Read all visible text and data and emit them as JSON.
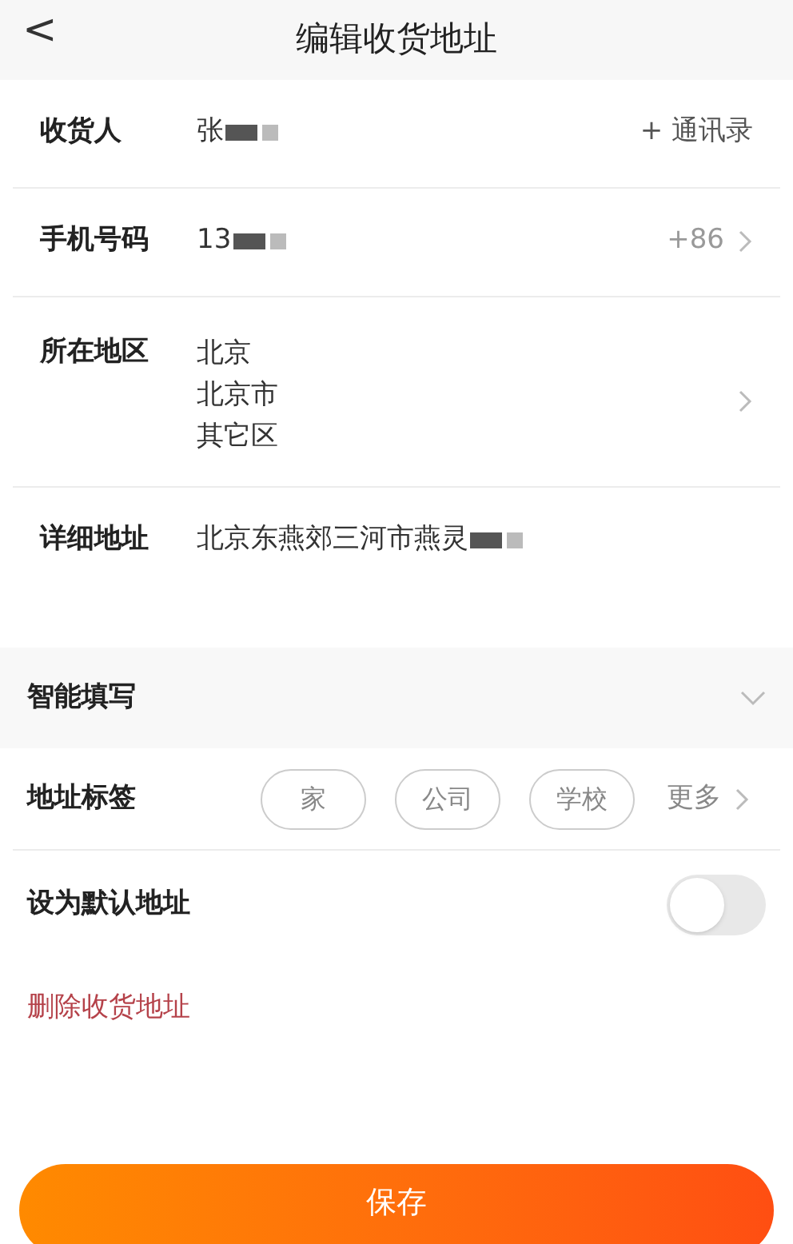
{
  "header": {
    "back": "<",
    "title": "编辑收货地址"
  },
  "fields": [
    {
      "kind": "text",
      "label": "收货人",
      "value": "张",
      "redacted": true,
      "action": "+ 通讯录",
      "chevron": false
    },
    {
      "kind": "text",
      "label": "手机号码",
      "value": "13",
      "redacted": true,
      "action": "+86",
      "chevron": true
    },
    {
      "kind": "lines",
      "label": "所在地区",
      "lines": [
        "北京",
        "北京市",
        "其它区"
      ],
      "chevron": true
    },
    {
      "kind": "text",
      "label": "详细地址",
      "value": "北京东燕郊三河市燕灵",
      "redacted": true,
      "chevron": false
    }
  ],
  "smart_fill": {
    "label": "智能填写",
    "expanded": false
  },
  "tags": {
    "label": "地址标签",
    "items": [
      {
        "label": "家",
        "selected": false
      },
      {
        "label": "公司",
        "selected": false
      },
      {
        "label": "学校",
        "selected": false
      }
    ],
    "more": "更多"
  },
  "default_address": {
    "label": "设为默认地址",
    "on": false
  },
  "delete": "删除收货地址",
  "save": "保存"
}
